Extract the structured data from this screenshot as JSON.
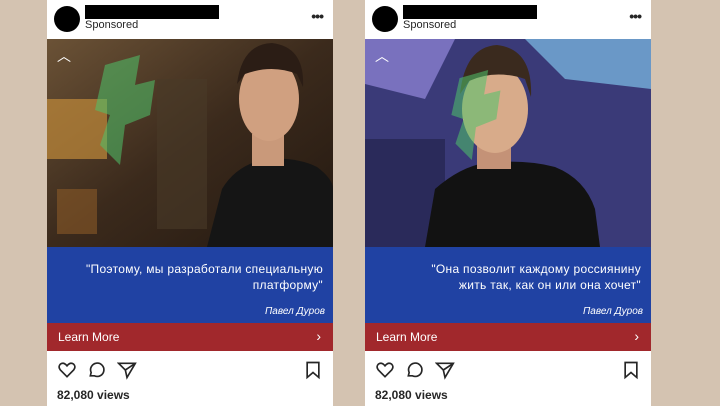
{
  "posts": [
    {
      "sponsored": "Sponsored",
      "quote": "\"Поэтому, мы разработали специальную платформу\"",
      "author": "Павел Дуров",
      "cta": "Learn More",
      "views": "82,080 views"
    },
    {
      "sponsored": "Sponsored",
      "quote": "\"Она позволит каждому россиянину жить так, как он или она хочет\"",
      "author": "Павел Дуров",
      "cta": "Learn More",
      "views": "82,080 views"
    }
  ],
  "colors": {
    "quote_bg": "#2042a3",
    "cta_bg": "#a1282c",
    "page_bg": "#d4c3b1",
    "watermark": "#4fc36a"
  },
  "icons": [
    "more-icon",
    "collapse-icon",
    "heart-icon",
    "comment-icon",
    "share-icon",
    "bookmark-icon",
    "chevron-right-icon"
  ]
}
